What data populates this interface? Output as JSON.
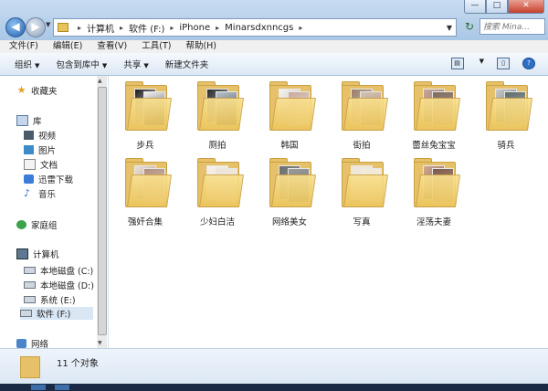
{
  "address": {
    "crumbs": [
      "计算机",
      "软件 (F:)",
      "iPhone",
      "Minarsdxnncgs"
    ],
    "search_placeholder": "搜索 Mina..."
  },
  "window_controls": {
    "minimize": "—",
    "maximize": "□",
    "close": "✕"
  },
  "menu": [
    "文件(F)",
    "编辑(E)",
    "查看(V)",
    "工具(T)",
    "帮助(H)"
  ],
  "toolbar": {
    "organize": "组织",
    "include_in_library": "包含到库中",
    "share": "共享",
    "new_folder": "新建文件夹"
  },
  "nav": {
    "favorites": "收藏夹",
    "libraries": "库",
    "lib_items": [
      "视频",
      "图片",
      "文档",
      "迅雷下载",
      "音乐"
    ],
    "homegroup": "家庭组",
    "computer": "计算机",
    "drives": [
      "本地磁盘 (C:)",
      "本地磁盘 (D:)",
      "系统 (E:)",
      "软件 (F:)"
    ],
    "network": "网络"
  },
  "folders": [
    {
      "name": "步兵"
    },
    {
      "name": "厕拍"
    },
    {
      "name": "韩国"
    },
    {
      "name": "街拍"
    },
    {
      "name": "蕾丝兔宝宝"
    },
    {
      "name": "骑兵"
    },
    {
      "name": "强奸合集"
    },
    {
      "name": "少妇白洁"
    },
    {
      "name": "网络美女"
    },
    {
      "name": "写真"
    },
    {
      "name": "淫荡夫妻"
    }
  ],
  "status": {
    "count": "11 个对象"
  },
  "colors": {
    "folder": "#e6c169",
    "accent": "#3c7dd8",
    "desktop": "#7f1e3c"
  }
}
